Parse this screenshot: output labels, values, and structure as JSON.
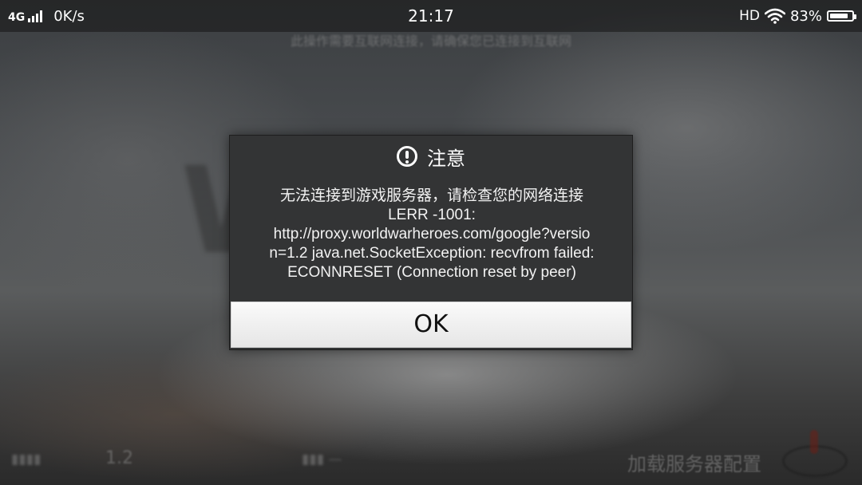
{
  "status_bar": {
    "network": "4G",
    "speed": "0K/s",
    "time": "21:17",
    "hd": "HD",
    "battery_percent": "83%",
    "battery_level": 0.83
  },
  "background": {
    "notice": "此操作需要互联网连接，请确保您已连接到互联网",
    "version_value": "1.2",
    "loading_text": "加载服务器配置"
  },
  "dialog": {
    "title": "注意",
    "message_lines": [
      "无法连接到游戏服务器，请检查您的网络连接",
      "LERR -1001:",
      "http://proxy.worldwarheroes.com/google?versio",
      "n=1.2 java.net.SocketException: recvfrom failed:",
      "ECONNRESET (Connection reset by peer)"
    ],
    "ok_label": "OK"
  },
  "colors": {
    "dialog_bg": "#333435",
    "button_bg": "#f2f2f2"
  }
}
